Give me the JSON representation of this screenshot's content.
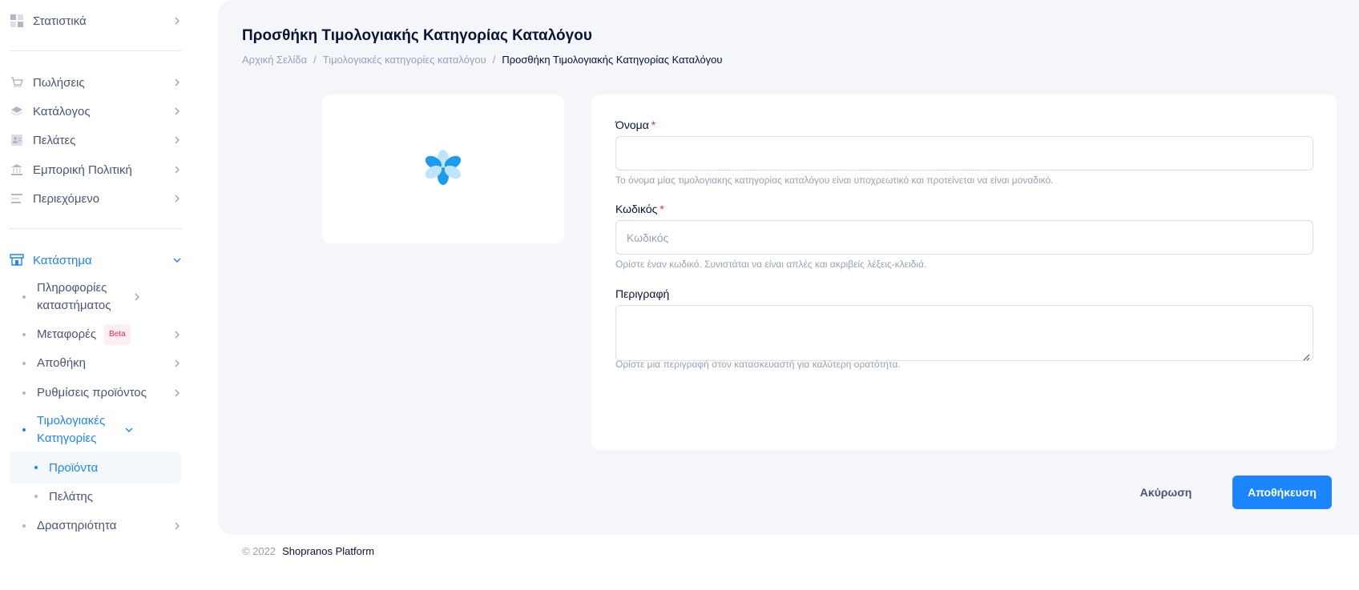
{
  "sidebar": {
    "top_items": [
      {
        "label": "Στατιστικά",
        "icon": "dashboard-icon"
      }
    ],
    "main_items": [
      {
        "label": "Πωλήσεις",
        "icon": "cart-icon"
      },
      {
        "label": "Κατάλογος",
        "icon": "layers-icon"
      },
      {
        "label": "Πελάτες",
        "icon": "contacts-icon"
      },
      {
        "label": "Εμπορική Πολιτική",
        "icon": "bank-icon"
      },
      {
        "label": "Περιεχόμενο",
        "icon": "content-icon"
      }
    ],
    "store": {
      "label": "Κατάστημα",
      "icon": "store-icon",
      "sub": [
        {
          "label": "Πληροφορίες καταστήματος"
        },
        {
          "label": "Μεταφορές",
          "badge": "Beta"
        },
        {
          "label": "Αποθήκη"
        },
        {
          "label": "Ρυθμίσεις προϊόντος"
        },
        {
          "label": "Τιμολογιακές Κατηγορίες"
        }
      ],
      "subsub": [
        {
          "label": "Προϊόντα"
        },
        {
          "label": "Πελάτης"
        }
      ],
      "last": {
        "label": "Δραστηριότητα"
      }
    }
  },
  "page": {
    "title": "Προσθήκη Τιμολογιακής Κατηγορίας Καταλόγου",
    "breadcrumb": {
      "home": "Αρχική Σελίδα",
      "parent": "Τιμολογιακές κατηγορίες καταλόγου",
      "current": "Προσθήκη Τιμολογιακής Κατηγορίας Καταλόγου",
      "sep": "/"
    }
  },
  "form": {
    "name_label": "Όνομα",
    "name_value": "",
    "name_help": "Το όνομα μίας τιμολογιακης κατηγορίας καταλόγου είναι υποχρεωτικό και προτείνεται να είναι μοναδικό.",
    "code_label": "Κωδικός",
    "code_placeholder": "Κωδικός",
    "code_help": "Ορίστε έναν κωδικό. Συνιστάται να είναι απλές και ακριβείς λέξεις-κλειδιά.",
    "desc_label": "Περιγραφή",
    "desc_help": "Ορίστε μια περιγραφή στον κατασκευαστή για καλύτερη ορατότητα.",
    "required_mark": "*"
  },
  "actions": {
    "cancel": "Ακύρωση",
    "save": "Αποθήκευση"
  },
  "footer": {
    "year": "© 2022",
    "brand": "Shopranos Platform"
  },
  "colors": {
    "accent": "#1b84ff",
    "required": "#f8285a",
    "bg": "#f4f6fa"
  }
}
